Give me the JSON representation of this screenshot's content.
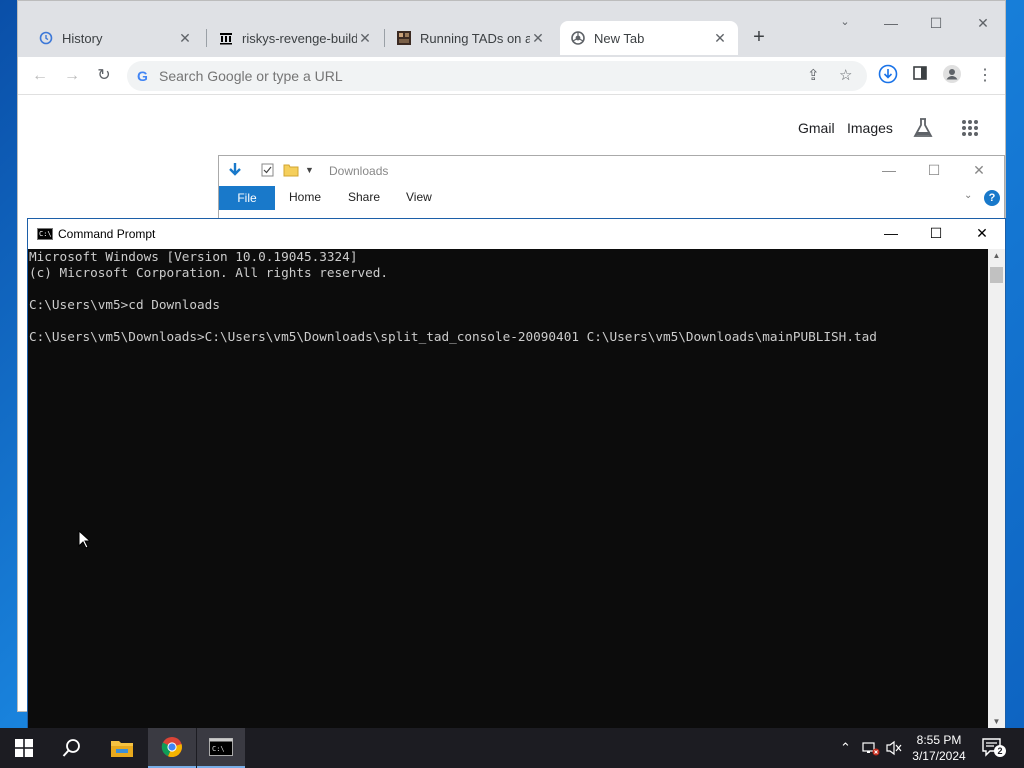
{
  "chrome": {
    "tabs": [
      {
        "title": "History",
        "icon": "history-icon"
      },
      {
        "title": "riskys-revenge-builds",
        "icon": "archive-icon"
      },
      {
        "title": "Running TADs on a re",
        "icon": "page-thumbnail-icon"
      },
      {
        "title": "New Tab",
        "icon": "chrome-icon"
      }
    ],
    "new_tab_symbol": "+",
    "omnibox_placeholder": "Search Google or type a URL",
    "page_links": {
      "gmail": "Gmail",
      "images": "Images"
    }
  },
  "explorer": {
    "title": "Downloads",
    "ribbon_tabs": [
      "File",
      "Home",
      "Share",
      "View"
    ]
  },
  "cmd": {
    "title": "Command Prompt",
    "lines": [
      "Microsoft Windows [Version 10.0.19045.3324]",
      "(c) Microsoft Corporation. All rights reserved.",
      "",
      "C:\\Users\\vm5>cd Downloads",
      "",
      "C:\\Users\\vm5\\Downloads>C:\\Users\\vm5\\Downloads\\split_tad_console-20090401 C:\\Users\\vm5\\Downloads\\mainPUBLISH.tad"
    ]
  },
  "taskbar": {
    "clock_time": "8:55 PM",
    "clock_date": "3/17/2024",
    "notification_count": "2"
  },
  "colors": {
    "desktop": "#1877d4",
    "console_bg": "#0c0c0c",
    "console_text": "#cccccc",
    "explorer_file_tab": "#1979ca"
  }
}
